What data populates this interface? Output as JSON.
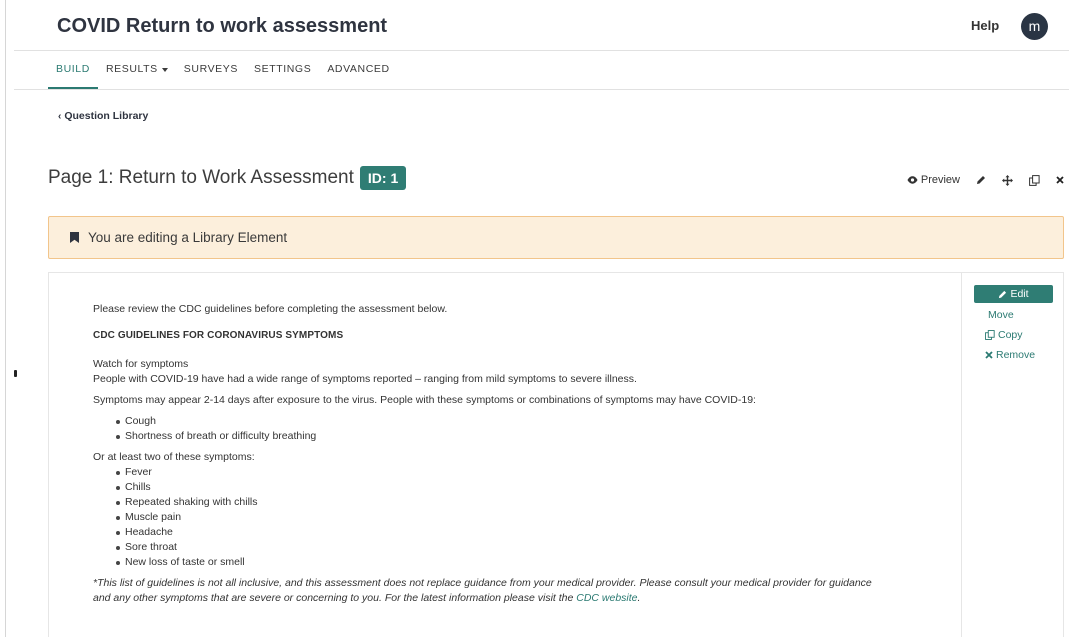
{
  "header": {
    "title": "COVID Return to work assessment",
    "help": "Help",
    "avatar_initial": "m"
  },
  "nav": {
    "tabs": [
      {
        "label": "BUILD",
        "active": true
      },
      {
        "label": "RESULTS",
        "dropdown": true
      },
      {
        "label": "SURVEYS"
      },
      {
        "label": "SETTINGS"
      },
      {
        "label": "ADVANCED"
      }
    ]
  },
  "breadcrumb": {
    "back_label": "Question Library"
  },
  "page": {
    "title": "Page 1: Return to Work Assessment",
    "id_badge": "ID: 1",
    "tools": {
      "preview": "Preview",
      "icons": [
        "eye-icon",
        "pencil-icon",
        "move-icon",
        "copy-icon",
        "close-icon"
      ]
    }
  },
  "notice": {
    "text": "You are editing a Library Element",
    "icon": "bookmark-icon"
  },
  "element": {
    "intro": "Please review the CDC guidelines before completing the assessment below.",
    "heading": "CDC GUIDELINES FOR CORONAVIRUS SYMPTOMS",
    "watch": "Watch for symptoms",
    "range": "People with COVID-19 have had a wide range of symptoms reported – ranging from mild symptoms to severe illness.",
    "appear": "Symptoms may appear 2-14 days after exposure to the virus. People with these symptoms or combinations of symptoms may have COVID-19:",
    "primary_symptoms": [
      "Cough",
      "Shortness of breath or difficulty breathing"
    ],
    "or_two": "Or at least two of these symptoms:",
    "secondary_symptoms": [
      "Fever",
      "Chills",
      "Repeated shaking with chills",
      "Muscle pain",
      "Headache",
      "Sore throat",
      "New loss of taste or smell"
    ],
    "note_line1": "*This list of guidelines is not all inclusive, and this assessment does not replace guidance from your medical provider. Please consult your medical provider for guidance",
    "note_line2": "and any other symptoms that are severe or concerning to you. For the latest information please visit the ",
    "note_link": "CDC website",
    "note_end": "."
  },
  "actions": {
    "edit": "Edit",
    "move": "Move",
    "copy": "Copy",
    "remove": "Remove"
  },
  "colors": {
    "accent": "#2f7d74",
    "notice_bg": "#fcefdc",
    "notice_border": "#f2c58b",
    "avatar_bg": "#2a3544"
  }
}
